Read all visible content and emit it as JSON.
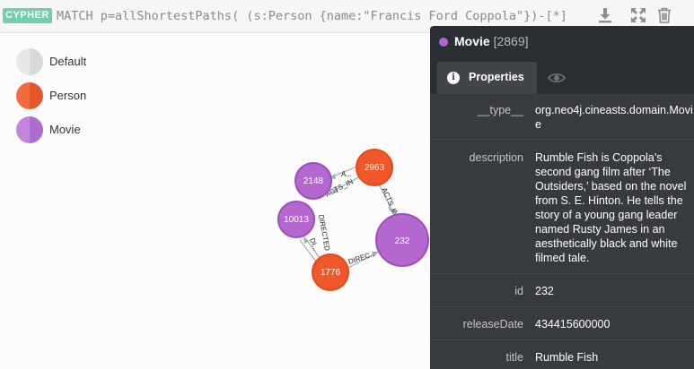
{
  "query": {
    "badge": "CYPHER",
    "text": "MATCH p=allShortestPaths( (s:Person {name:\"Francis Ford Coppola\"})-[*]"
  },
  "toolbar": {
    "download_icon": "download-icon",
    "expand_icon": "expand-icon",
    "delete_icon": "trash-icon"
  },
  "legend": [
    {
      "label": "Default",
      "color_left": "#e8e8e8",
      "color_right": "#d9d9d9"
    },
    {
      "label": "Person",
      "color_left": "#f26b3a",
      "color_right": "#e2582a"
    },
    {
      "label": "Movie",
      "color_left": "#c386dc",
      "color_right": "#ae6ccd"
    }
  ],
  "graph": {
    "nodes": [
      {
        "id": "2963",
        "type": "Person"
      },
      {
        "id": "2148",
        "type": "Movie"
      },
      {
        "id": "10013",
        "type": "Movie"
      },
      {
        "id": "232",
        "type": "Movie"
      },
      {
        "id": "1776",
        "type": "Person"
      }
    ],
    "relationships": [
      {
        "label": "A...",
        "from": "2963",
        "to": "2148"
      },
      {
        "label": "ACTS_IN",
        "from": "2963",
        "to": "2148"
      },
      {
        "label": "ACTS_IN",
        "from": "2963",
        "to": "232"
      },
      {
        "label": "DIRECTED",
        "from": "1776",
        "to": "10013"
      },
      {
        "label": "DI...",
        "from": "1776",
        "to": "10013"
      },
      {
        "label": "DIREC...",
        "from": "1776",
        "to": "232"
      }
    ]
  },
  "colors": {
    "person": "#f0582a",
    "person_stroke": "#e24a1c",
    "movie": "#b467cf",
    "movie_stroke": "#9c4fba",
    "edge": "#a5abb6"
  },
  "panel": {
    "label": "Movie",
    "id": "[2869]",
    "dot_color": "#b467cf",
    "tab_properties": "Properties",
    "tab_style_icon": "eye-icon",
    "properties": [
      {
        "key": "__type__",
        "value": "org.neo4j.cineasts.domain.Movie"
      },
      {
        "key": "description",
        "value": "Rumble Fish is Coppola’s second gang film after ‘The Outsiders,’ based on the novel from S. E. Hinton. He tells the story of a young gang leader named Rusty James in an aesthetically black and white filmed tale."
      },
      {
        "key": "id",
        "value": "232"
      },
      {
        "key": "releaseDate",
        "value": "434415600000"
      },
      {
        "key": "title",
        "value": "Rumble Fish"
      }
    ]
  }
}
